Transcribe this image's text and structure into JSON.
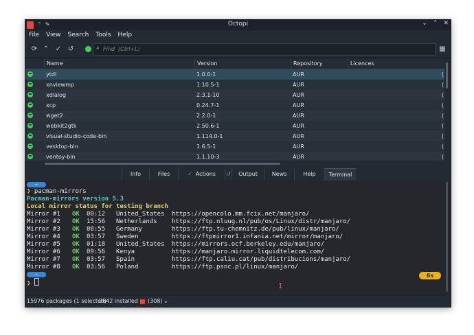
{
  "window": {
    "title": "Octopi"
  },
  "menu": [
    "File",
    "View",
    "Search",
    "Tools",
    "Help"
  ],
  "search": {
    "placeholder": "Find  (Ctrl+L)",
    "value": ""
  },
  "table": {
    "headers": [
      "Name",
      "Version",
      "Repository",
      "Licences"
    ],
    "rows": [
      {
        "name": "ytdl",
        "version": "1.0.0-1",
        "repo": "AUR",
        "lic": "("
      },
      {
        "name": "xnviewmp",
        "version": "1.10.5-1",
        "repo": "AUR",
        "lic": "("
      },
      {
        "name": "xdialog",
        "version": "2.3.1-10",
        "repo": "AUR",
        "lic": "("
      },
      {
        "name": "xcp",
        "version": "0.24.7-1",
        "repo": "AUR",
        "lic": "("
      },
      {
        "name": "wget2",
        "version": "2.2.0-1",
        "repo": "AUR",
        "lic": "("
      },
      {
        "name": "webkit2gtk",
        "version": "2.50.6-1",
        "repo": "AUR",
        "lic": "("
      },
      {
        "name": "visual-studio-code-bin",
        "version": "1.114.0-1",
        "repo": "AUR",
        "lic": "("
      },
      {
        "name": "vesktop-bin",
        "version": "1.6.5-1",
        "repo": "AUR",
        "lic": "("
      },
      {
        "name": "ventoy-bin",
        "version": "1.1.10-3",
        "repo": "AUR",
        "lic": "("
      }
    ]
  },
  "tabs": [
    "Info",
    "Files",
    "Actions",
    "Output",
    "News",
    "Help",
    "Terminal"
  ],
  "terminal": {
    "home_pill": "~",
    "command": "pacman-mirrors",
    "version_line": "Pacman-mirrors version 5.3",
    "status_line": "Local mirror status for testing branch",
    "mirrors": [
      {
        "label": "Mirror #1",
        "status": "OK",
        "time": "00:12",
        "country": "United_States",
        "url": "https://opencolo.mm.fcix.net/manjaro/"
      },
      {
        "label": "Mirror #2",
        "status": "OK",
        "time": "15:56",
        "country": "Netherlands",
        "url": "https://ftp.nluug.nl/pub/os/Linux/distr/manjaro/"
      },
      {
        "label": "Mirror #3",
        "status": "OK",
        "time": "08:55",
        "country": "Germany",
        "url": "https://ftp.tu-chemnitz.de/pub/linux/manjaro/"
      },
      {
        "label": "Mirror #4",
        "status": "OK",
        "time": "03:57",
        "country": "Sweden",
        "url": "https://ftpmirror1.infania.net/mirror/manjaro/"
      },
      {
        "label": "Mirror #5",
        "status": "OK",
        "time": "01:18",
        "country": "United_States",
        "url": "https://mirrors.ocf.berkeley.edu/manjaro/"
      },
      {
        "label": "Mirror #6",
        "status": "OK",
        "time": "09:56",
        "country": "Kenya",
        "url": "https://manjaro.mirror.liquidtelecom.com/"
      },
      {
        "label": "Mirror #7",
        "status": "OK",
        "time": "03:57",
        "country": "Spain",
        "url": "https://ftp.caliu.cat/pub/distribucions/manjaro/"
      },
      {
        "label": "Mirror #8",
        "status": "OK",
        "time": "03:56",
        "country": "Poland",
        "url": "https://ftp.psnc.pl/linux/manjaro/"
      }
    ],
    "timer": "6s"
  },
  "status": {
    "packages": "15976 packages (1 selected)",
    "installed": "2642 installed",
    "updates": "(308)"
  },
  "colors": {
    "accent": "#3c86d6",
    "ok": "#6ad35a",
    "timer": "#e8b41a",
    "updates_badge": "#e0473f"
  }
}
